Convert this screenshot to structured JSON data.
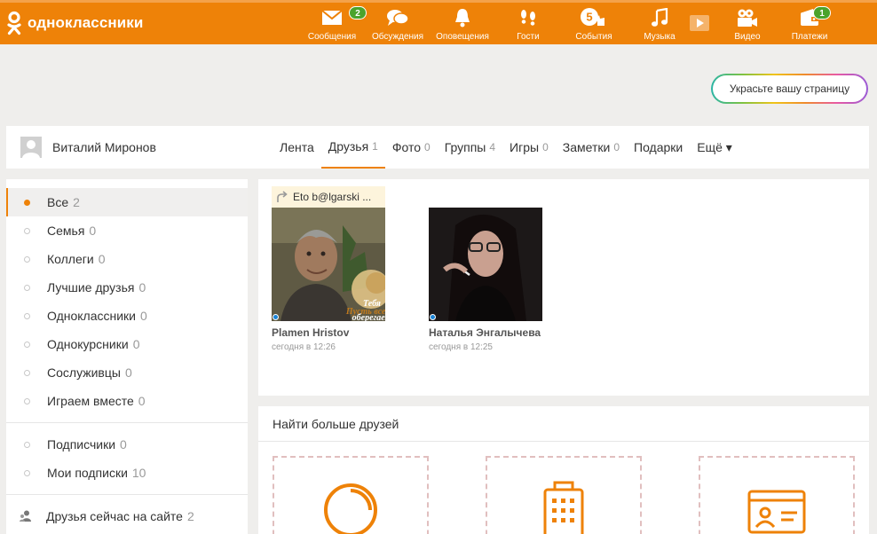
{
  "colors": {
    "brand": "#ee8208",
    "online": "#1b84d6",
    "badge": "#4ba32c"
  },
  "header": {
    "logo_text": "одноклассники",
    "nav": [
      {
        "label": "Сообщения",
        "icon": "envelope-icon",
        "badge": "2"
      },
      {
        "label": "Обсуждения",
        "icon": "chat-bubbles-icon"
      },
      {
        "label": "Оповещения",
        "icon": "bell-icon"
      },
      {
        "label": "Гости",
        "icon": "footprints-icon"
      },
      {
        "label": "События",
        "icon": "events-icon",
        "badge_inline": "5"
      },
      {
        "label": "Музыка",
        "icon": "music-note-icon"
      },
      {
        "label": "",
        "icon": "play-icon"
      },
      {
        "label": "Видео",
        "icon": "video-camera-icon"
      },
      {
        "label": "Платежи",
        "icon": "wallet-icon",
        "badge": "1"
      }
    ]
  },
  "decorate_button": "Украсьте вашу страницу",
  "profile": {
    "name": "Виталий Миронов",
    "tabs": [
      {
        "label": "Лента",
        "count": ""
      },
      {
        "label": "Друзья",
        "count": "1"
      },
      {
        "label": "Фото",
        "count": "0"
      },
      {
        "label": "Группы",
        "count": "4"
      },
      {
        "label": "Игры",
        "count": "0"
      },
      {
        "label": "Заметки",
        "count": "0"
      },
      {
        "label": "Подарки",
        "count": ""
      },
      {
        "label": "Ещё ▾",
        "count": ""
      }
    ]
  },
  "sidebar": {
    "groups": [
      {
        "label": "Все",
        "count": "2"
      },
      {
        "label": "Семья",
        "count": "0"
      },
      {
        "label": "Коллеги",
        "count": "0"
      },
      {
        "label": "Лучшие друзья",
        "count": "0"
      },
      {
        "label": "Одноклассники",
        "count": "0"
      },
      {
        "label": "Однокурсники",
        "count": "0"
      },
      {
        "label": "Сослуживцы",
        "count": "0"
      },
      {
        "label": "Играем вместе",
        "count": "0"
      }
    ],
    "subs": [
      {
        "label": "Подписчики",
        "count": "0"
      },
      {
        "label": "Мои подписки",
        "count": "10"
      }
    ],
    "online": {
      "label": "Друзья сейчас на сайте",
      "count": "2"
    }
  },
  "friends": [
    {
      "name": "Plamen Hristov",
      "time": "сегодня в 12:26",
      "share": "Eto b@lgarski ...",
      "overlay": [
        "Пусть всегда",
        "Тебя",
        "оберегает"
      ]
    },
    {
      "name": "Наталья Энгалычева",
      "time": "сегодня в 12:25"
    }
  ],
  "find": {
    "title": "Найти больше друзей"
  }
}
